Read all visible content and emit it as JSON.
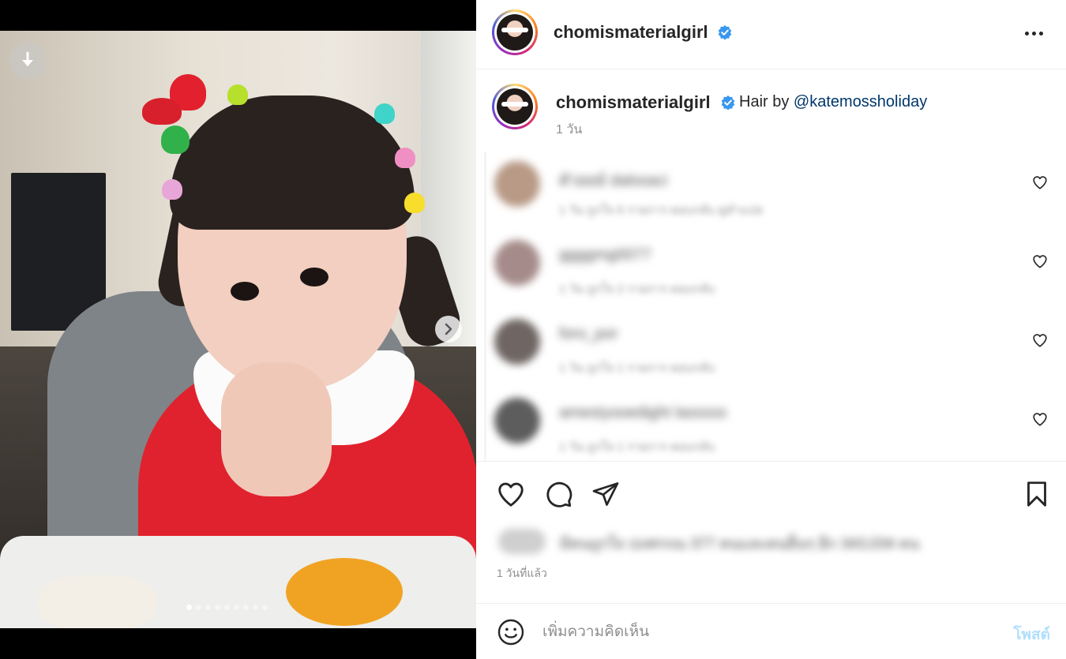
{
  "post": {
    "username": "chomismaterialgirl",
    "verified_icon": "verified-badge-icon",
    "caption_prefix": "Hair by",
    "caption_mention": "@katemossholiday",
    "caption_time": "1 วัน",
    "post_time": "1 วันที่แล้ว"
  },
  "media": {
    "carousel_total": 9,
    "carousel_active_index": 0,
    "download_icon": "download-arrow-icon",
    "next_icon": "chevron-right-icon"
  },
  "comments": [
    {
      "blur_user": "ตัวยยย์ dalssaci",
      "blur_sub": "1 วัน  ถูกใจ 6 รายการ  ตอบกลับ  ดูคำแปล",
      "avatar_color": "#b89a86",
      "accent": "#e0394b"
    },
    {
      "blur_user": "ggggmg0077",
      "blur_sub": "1 วัน  ถูกใจ 2 รายการ  ตอบกลับ",
      "avatar_color": "#a58c8a",
      "accent": "#e0a060"
    },
    {
      "blur_user": "foro_por",
      "blur_sub": "1 วัน  ถูกใจ 1 รายการ  ตอบกลับ",
      "avatar_color": "#6f6663",
      "accent": "#f0b430"
    },
    {
      "blur_user": "amestyooedight lasssss",
      "blur_sub": "1 วัน  ถูกใจ 1 รายการ  ตอบกลับ",
      "avatar_color": "#5d5d5d",
      "accent": "#e0a060"
    }
  ],
  "liked_by": {
    "blur_text": "มีคนถูกใจ ปงฟรรณ 377 คนและคนอื่นๆ อีก 343,034 คน"
  },
  "comment_box": {
    "placeholder": "เพิ่มความคิดเห็น",
    "post_label": "โพสต์"
  },
  "icons": {
    "more": "more-options-icon",
    "like": "heart-icon",
    "comment": "comment-bubble-icon",
    "share": "paper-plane-icon",
    "save": "bookmark-icon",
    "emoji": "emoji-smiley-icon"
  },
  "colors": {
    "verified": "#3897f0",
    "mention": "#00376b",
    "post_disabled": "#b2dffc",
    "secondary_text": "#8e8e8e"
  }
}
